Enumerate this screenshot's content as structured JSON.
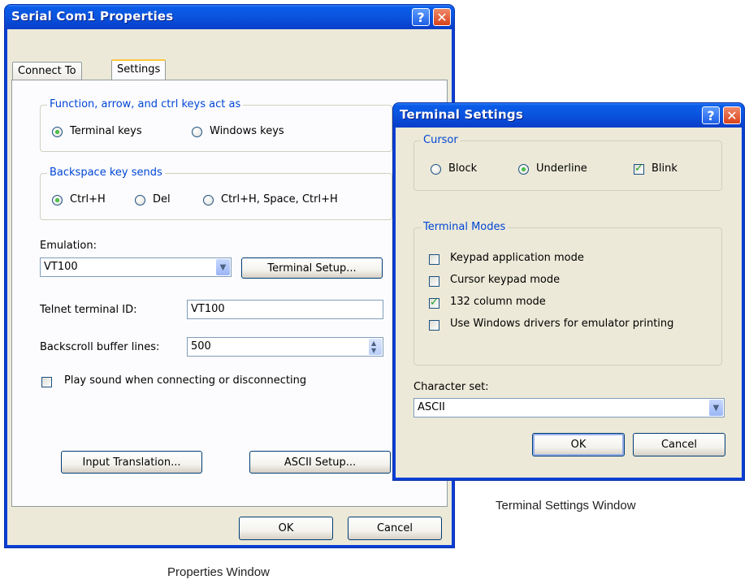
{
  "props_window": {
    "title": "Serial Com1 Properties",
    "help_glyph": "?",
    "close_glyph": "✕",
    "tabs": [
      "Connect To",
      "Settings"
    ],
    "function_group": {
      "label": "Function, arrow, and ctrl keys act as",
      "options": [
        "Terminal keys",
        "Windows keys"
      ],
      "selected": "Terminal keys"
    },
    "backspace_group": {
      "label": "Backspace key sends",
      "options": [
        "Ctrl+H",
        "Del",
        "Ctrl+H, Space, Ctrl+H"
      ],
      "selected": "Ctrl+H"
    },
    "emulation_label": "Emulation:",
    "emulation_value": "VT100",
    "terminal_setup_label": "Terminal Setup...",
    "telnet_label": "Telnet terminal ID:",
    "telnet_value": "VT100",
    "backscroll_label": "Backscroll buffer lines:",
    "backscroll_value": "500",
    "play_sound_label": "Play sound when connecting or disconnecting",
    "play_sound_checked": false,
    "input_translation_label": "Input Translation...",
    "ascii_setup_label": "ASCII Setup...",
    "ok_label": "OK",
    "cancel_label": "Cancel"
  },
  "terminal_window": {
    "title": "Terminal Settings",
    "help_glyph": "?",
    "close_glyph": "✕",
    "cursor_group": {
      "label": "Cursor",
      "options": [
        "Block",
        "Underline"
      ],
      "selected": "Underline",
      "blink_label": "Blink",
      "blink_checked": true
    },
    "modes_group": {
      "label": "Terminal Modes",
      "items": [
        {
          "label": "Keypad application mode",
          "checked": false
        },
        {
          "label": "Cursor keypad mode",
          "checked": false
        },
        {
          "label": "132 column mode",
          "checked": true
        },
        {
          "label": "Use Windows drivers for emulator printing",
          "checked": false
        }
      ]
    },
    "charset_label": "Character set:",
    "charset_value": "ASCII",
    "ok_label": "OK",
    "cancel_label": "Cancel"
  },
  "captions": {
    "terminal": "Terminal Settings Window",
    "properties": "Properties Window"
  },
  "colors": {
    "titlebar": "#0a55e0",
    "dialog_face": "#ece9d8",
    "tab_panel": "#fcfcfe",
    "groupbox_label": "#0046d5",
    "close_button": "#d9431c"
  },
  "icons": {
    "combo_arrow": "chevron-down-icon",
    "spin": "spin-updown-icon",
    "help": "help-icon",
    "close": "close-icon"
  }
}
